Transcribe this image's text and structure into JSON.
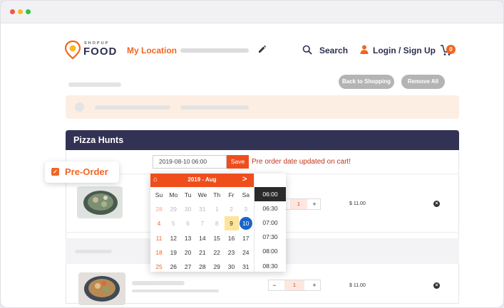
{
  "header": {
    "logo_small": "SHOPUP",
    "logo_big": "FOOD",
    "my_location": "My Location",
    "search": "Search",
    "login": "Login / Sign Up",
    "cart_count": "0"
  },
  "toolbar": {
    "back_to_shopping": "Back to Shopping",
    "remove_all": "Remove All"
  },
  "restaurant": {
    "name": "Pizza Hunts"
  },
  "preorder": {
    "badge": "Pre-Order",
    "date_value": "2019-08-10 06:00",
    "save": "Save",
    "message": "Pre order date updated on cart!"
  },
  "calendar": {
    "month": "2019 - Aug",
    "next": ">",
    "weekdays": [
      "Su",
      "Mo",
      "Tu",
      "We",
      "Th",
      "Fr",
      "Sa"
    ],
    "weeks": [
      [
        "28",
        "29",
        "30",
        "31",
        "1",
        "2",
        "3"
      ],
      [
        "4",
        "5",
        "6",
        "7",
        "8",
        "9",
        "10"
      ],
      [
        "11",
        "12",
        "13",
        "14",
        "15",
        "16",
        "17"
      ],
      [
        "18",
        "19",
        "20",
        "21",
        "22",
        "23",
        "24"
      ],
      [
        "25",
        "26",
        "27",
        "28",
        "29",
        "30",
        "31"
      ]
    ],
    "today": "9",
    "selected": "10",
    "times": [
      "06:00",
      "06:30",
      "07:00",
      "07:30",
      "08:00",
      "08:30"
    ],
    "selected_time": "06:00"
  },
  "cart_items": [
    {
      "qty": "1",
      "price": "$ 11.00",
      "minus": "",
      "plus": "+"
    },
    {
      "qty": "1",
      "price": "$ 11.00",
      "minus": "−",
      "plus": "+"
    }
  ],
  "colors": {
    "accent": "#f26522",
    "header_bar": "#323354",
    "selected_day": "#1a64c8"
  }
}
